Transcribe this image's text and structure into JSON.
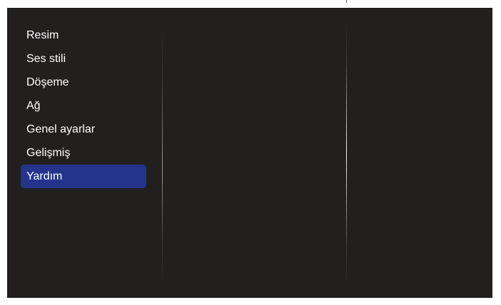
{
  "menu": {
    "items": [
      {
        "label": "Resim",
        "selected": false
      },
      {
        "label": "Ses stili",
        "selected": false
      },
      {
        "label": "Döşeme",
        "selected": false
      },
      {
        "label": "Ağ",
        "selected": false
      },
      {
        "label": "Genel ayarlar",
        "selected": false
      },
      {
        "label": "Gelişmiş",
        "selected": false
      },
      {
        "label": "Yardım",
        "selected": true
      }
    ]
  },
  "colors": {
    "background": "#221f1f",
    "selected_highlight": "#24348c",
    "text": "#ffffff"
  }
}
